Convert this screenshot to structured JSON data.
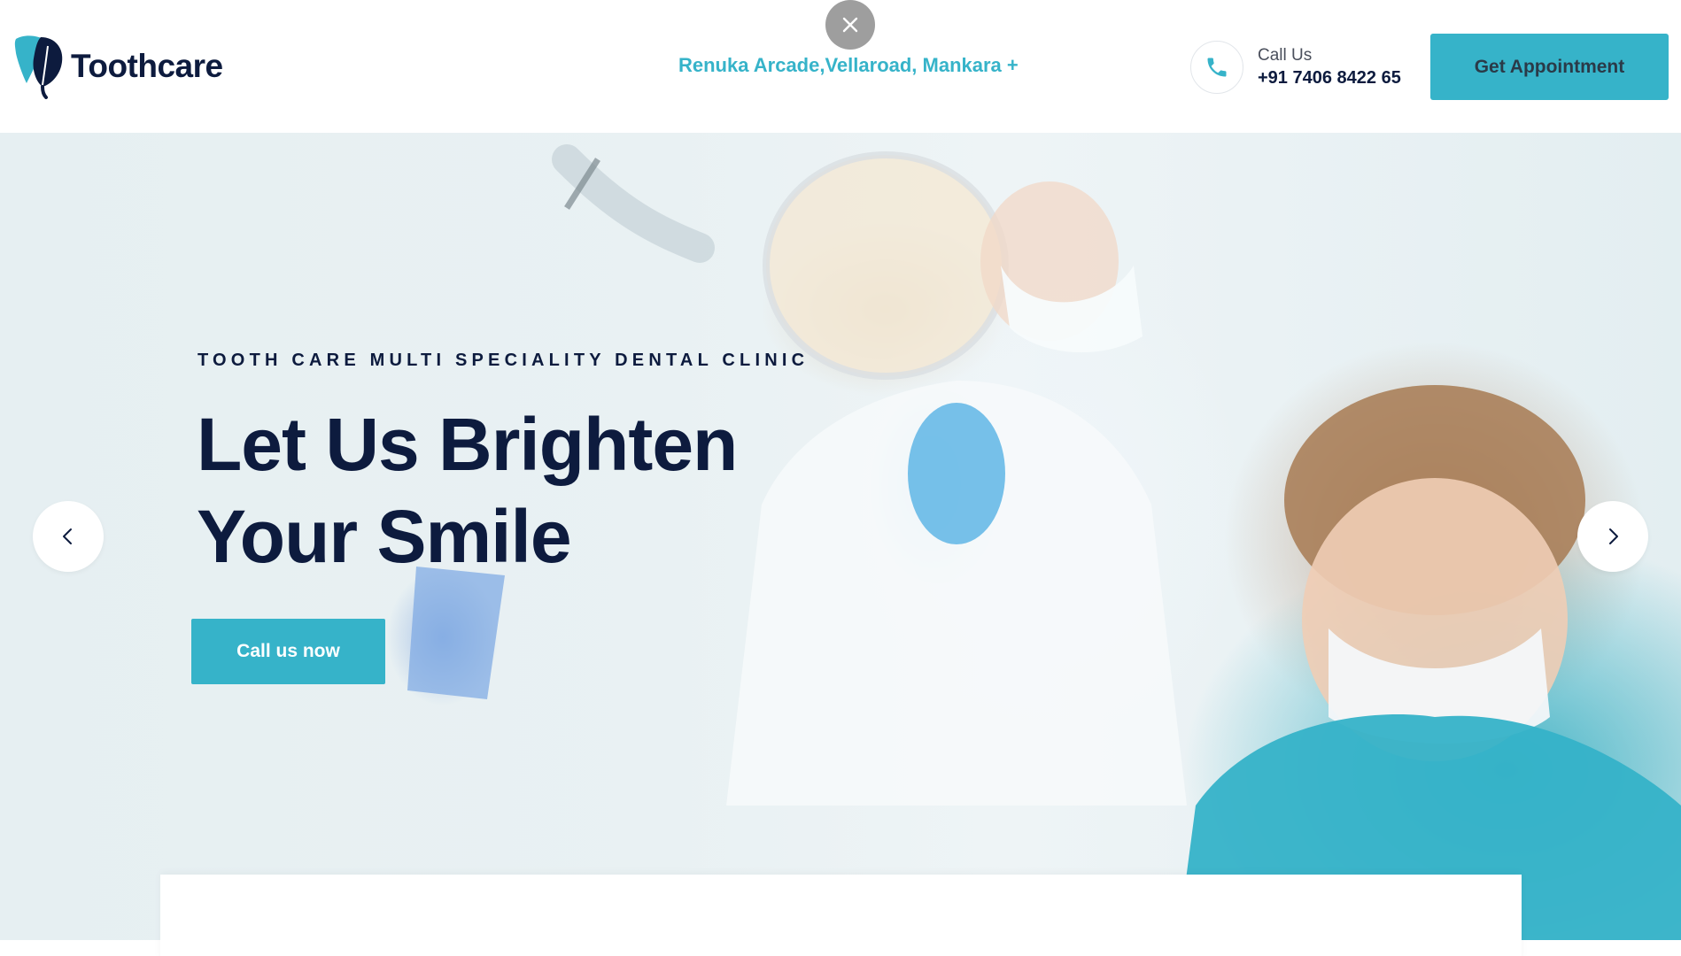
{
  "header": {
    "logo_text": "Toothcare",
    "address": "Renuka Arcade,Vellaroad, Mankara +",
    "call_label": "Call Us",
    "call_number": "+91 7406 8422 65",
    "appointment_label": "Get Appointment"
  },
  "hero": {
    "subtitle": "TOOTH CARE MULTI SPECIALITY DENTAL CLINIC",
    "title_line1": "Let Us Brighten",
    "title_line2": "Your Smile",
    "cta_label": "Call us now"
  },
  "icons": {
    "logo": "tooth-leaf-logo-icon",
    "close": "close-icon",
    "phone": "phone-icon",
    "prev": "chevron-left-icon",
    "next": "chevron-right-icon"
  },
  "colors": {
    "accent": "#36b3c9",
    "navy": "#0d1b3e",
    "close_bg": "#9e9e9e"
  }
}
